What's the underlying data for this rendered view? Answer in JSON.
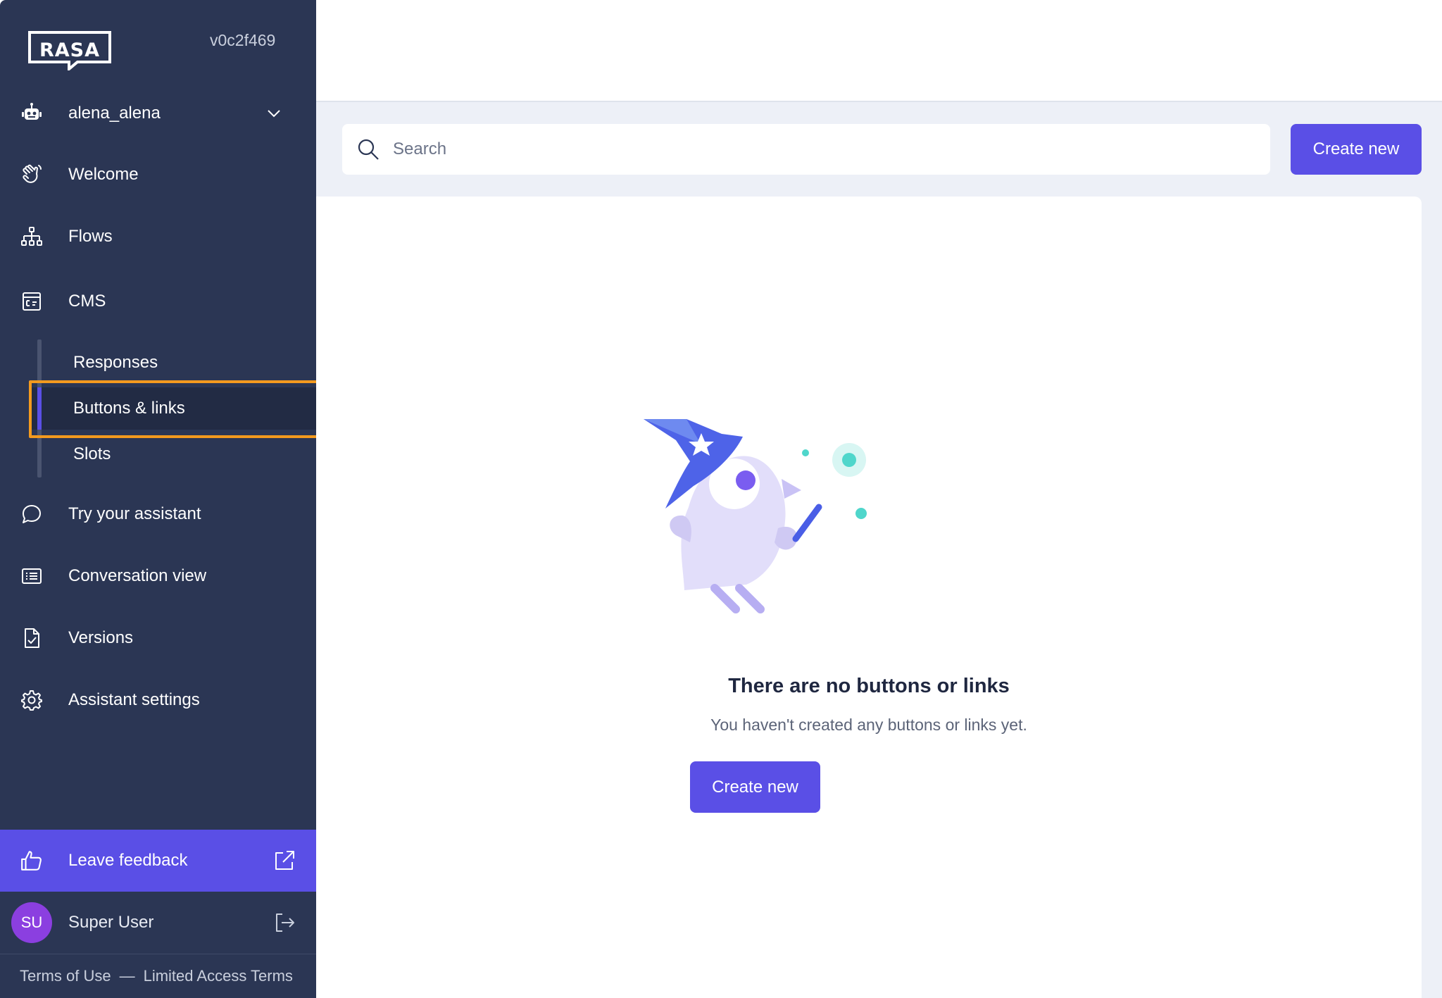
{
  "sidebar": {
    "version": "v0c2f469",
    "assistant_name": "alena_alena",
    "nav": {
      "welcome": "Welcome",
      "flows": "Flows",
      "cms": "CMS",
      "try_assistant": "Try your assistant",
      "conversation_view": "Conversation view",
      "versions": "Versions",
      "assistant_settings": "Assistant settings"
    },
    "cms_items": {
      "responses": "Responses",
      "buttons_links": "Buttons & links",
      "slots": "Slots"
    },
    "feedback_label": "Leave feedback",
    "user": {
      "initials": "SU",
      "name": "Super User"
    },
    "footer": {
      "terms": "Terms of Use",
      "separator": "—",
      "limited": "Limited Access Terms"
    }
  },
  "toolbar": {
    "search_placeholder": "Search",
    "create_label": "Create new"
  },
  "empty_state": {
    "title": "There are no buttons or links",
    "subtitle": "You haven't created any buttons or links yet.",
    "create_label": "Create new"
  },
  "colors": {
    "sidebar_bg": "#2b3654",
    "accent": "#5a4fe6",
    "highlight": "#f39a1f",
    "content_bg": "#edf0f7"
  }
}
